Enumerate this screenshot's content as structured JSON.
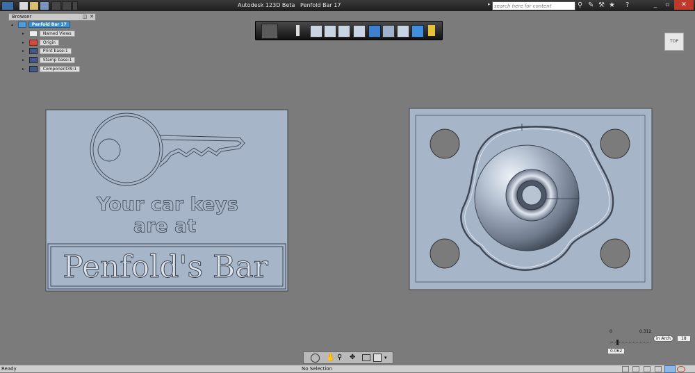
{
  "app": {
    "title": "Autodesk 123D Beta",
    "document": "Penfold Bar 17"
  },
  "search": {
    "placeholder": "search here for content"
  },
  "browser": {
    "title": "Browser",
    "root": "Penfold Bar 17",
    "items": [
      {
        "label": "Named Views",
        "icon": "views-icon"
      },
      {
        "label": "Origin",
        "icon": "origin-icon"
      },
      {
        "label": "Print base:1",
        "icon": "component-icon"
      },
      {
        "label": "Stamp base:1",
        "icon": "component-icon"
      },
      {
        "label": "Component39:1",
        "icon": "component-icon"
      }
    ]
  },
  "viewcube": {
    "label": "TOP"
  },
  "sign": {
    "line1": "Your car keys",
    "line2": "are at",
    "line3": "Penfold's Bar"
  },
  "ruler": {
    "min": "0",
    "max": "0.312",
    "value": "0.062",
    "unit": "in Arch",
    "scale": "18"
  },
  "status": {
    "left": "Ready",
    "center": "No Selection"
  },
  "colors": {
    "viewport": "#7b7b7b",
    "model": "#a7b5c9",
    "model_dark": "#5b6678",
    "highlight": "#3b8fd1"
  }
}
